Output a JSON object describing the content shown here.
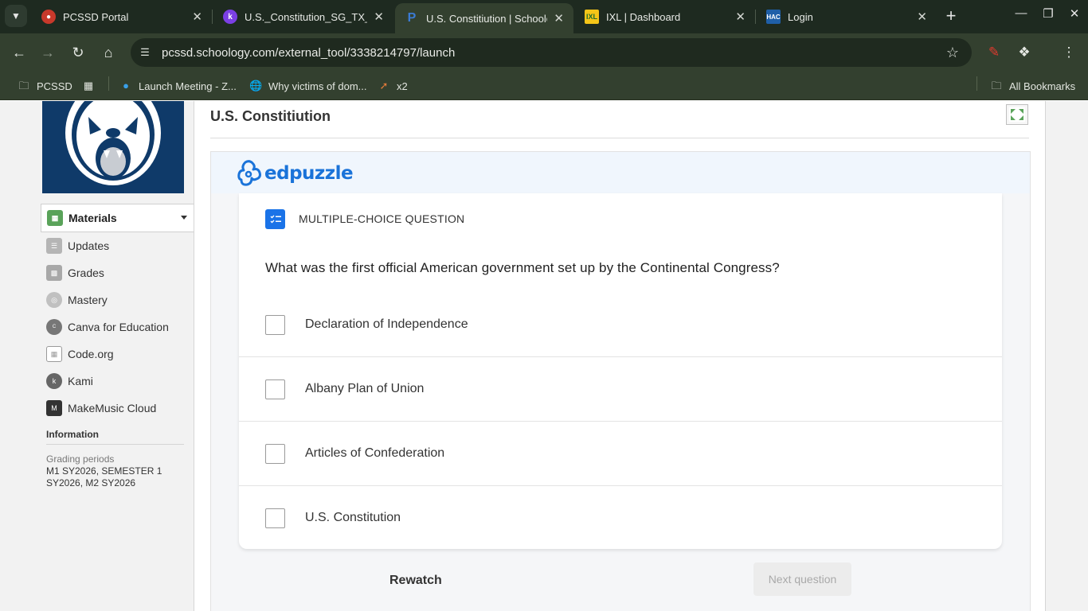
{
  "browser": {
    "tabs": [
      {
        "title": "PCSSD Portal",
        "color": "#c8392b"
      },
      {
        "title": "U.S._Constitution_SG_TX_F",
        "color": "#7b3fe4"
      },
      {
        "title": "U.S. Constitiution | Schoolo",
        "color": "#3b7bd4"
      },
      {
        "title": "IXL | Dashboard",
        "color": "#f5c518"
      },
      {
        "title": "Login",
        "color": "#1f5fa8"
      }
    ],
    "url": "pcssd.schoology.com/external_tool/3338214797/launch",
    "bookmarks": {
      "folder": "PCSSD",
      "items": [
        "Launch Meeting - Z...",
        "Why victims of dom...",
        "x2"
      ],
      "all": "All Bookmarks"
    }
  },
  "sidebar": {
    "items": [
      {
        "label": "Materials",
        "icon": "materials-icon",
        "color": "#5aa35a"
      },
      {
        "label": "Updates",
        "icon": "updates-icon",
        "color": "#b5b5b5"
      },
      {
        "label": "Grades",
        "icon": "grades-icon",
        "color": "#a8a8a8"
      },
      {
        "label": "Mastery",
        "icon": "mastery-icon",
        "color": "#c0c0c0"
      },
      {
        "label": "Canva for Education",
        "icon": "canva-icon",
        "color": "#777777"
      },
      {
        "label": "Code.org",
        "icon": "code-org-icon",
        "color": "#9a9a9a"
      },
      {
        "label": "Kami",
        "icon": "kami-icon",
        "color": "#666666"
      },
      {
        "label": "MakeMusic Cloud",
        "icon": "makemusic-icon",
        "color": "#333333"
      }
    ],
    "info_heading": "Information",
    "grading_label": "Grading periods",
    "grading_value": "M1 SY2026, SEMESTER 1 SY2026, M2 SY2026"
  },
  "main": {
    "title": "U.S. Constitiution",
    "edpuzzle_brand": "edpuzzle",
    "question_type": "MULTIPLE-CHOICE QUESTION",
    "question": "What was the first official American government set up by the Continental Congress?",
    "options": [
      "Declaration of Independence",
      "Albany Plan of Union",
      "Articles of Confederation",
      "U.S. Constitution"
    ],
    "rewatch": "Rewatch",
    "next": "Next question"
  }
}
